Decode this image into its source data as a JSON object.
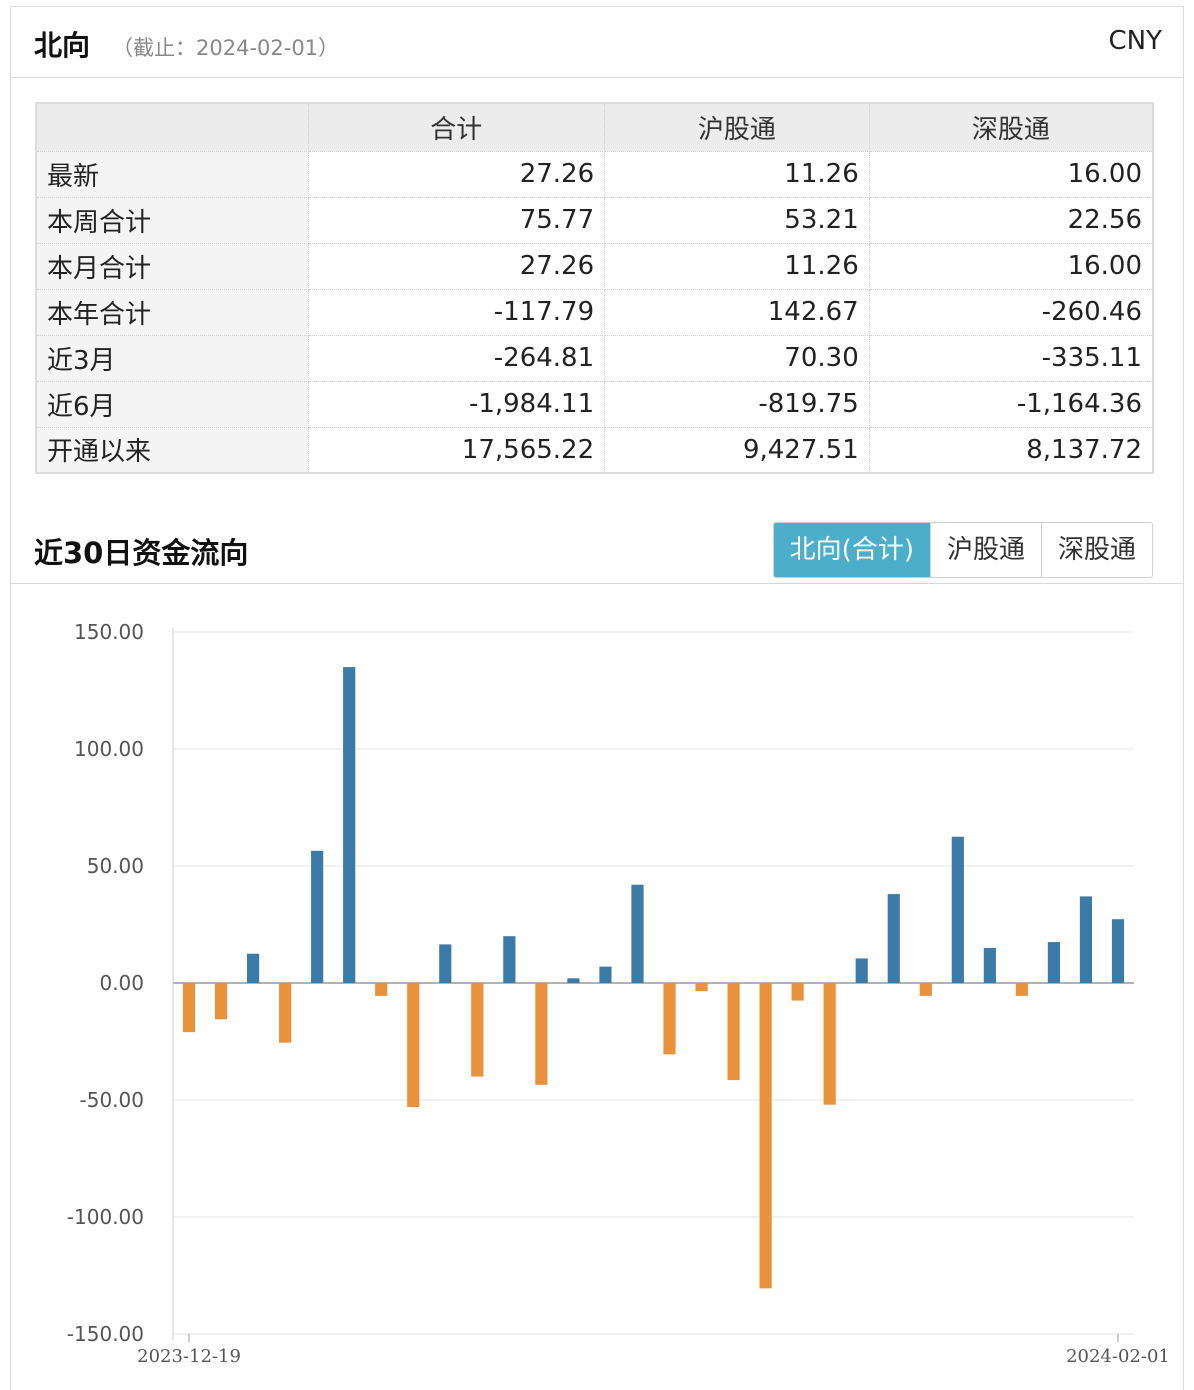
{
  "header": {
    "title": "北向",
    "as_of": "（截止：2024-02-01）",
    "currency": "CNY"
  },
  "summary_table": {
    "columns": [
      "合计",
      "沪股通",
      "深股通"
    ],
    "rows": [
      {
        "label": "最新",
        "values": [
          "27.26",
          "11.26",
          "16.00"
        ]
      },
      {
        "label": "本周合计",
        "values": [
          "75.77",
          "53.21",
          "22.56"
        ]
      },
      {
        "label": "本月合计",
        "values": [
          "27.26",
          "11.26",
          "16.00"
        ]
      },
      {
        "label": "本年合计",
        "values": [
          "-117.79",
          "142.67",
          "-260.46"
        ]
      },
      {
        "label": "近3月",
        "values": [
          "-264.81",
          "70.30",
          "-335.11"
        ]
      },
      {
        "label": "近6月",
        "values": [
          "-1,984.11",
          "-819.75",
          "-1,164.36"
        ]
      },
      {
        "label": "开通以来",
        "values": [
          "17,565.22",
          "9,427.51",
          "8,137.72"
        ]
      }
    ]
  },
  "flow_section": {
    "title": "近30日资金流向",
    "tabs": [
      {
        "label": "北向(合计)",
        "active": true
      },
      {
        "label": "沪股通",
        "active": false
      },
      {
        "label": "深股通",
        "active": false
      }
    ]
  },
  "colors": {
    "positive": "#3e7aa6",
    "negative": "#e8923c",
    "tab_active": "#4daec9"
  },
  "chart_data": {
    "type": "bar",
    "title": "",
    "xlabel": "",
    "ylabel": "",
    "ylim": [
      -150,
      150
    ],
    "yticks": [
      "150.00",
      "100.00",
      "50.00",
      "0.00",
      "-50.00",
      "-100.00",
      "-150.00"
    ],
    "x_tick_labels": [
      "2023-12-19",
      "2024-02-01"
    ],
    "values": [
      -21,
      -15.5,
      12.5,
      -25.5,
      56.5,
      135,
      -5.5,
      -53,
      16.5,
      -40,
      20,
      -43.5,
      2,
      7,
      42,
      -30.5,
      -3.5,
      -41.5,
      -130.5,
      -7.5,
      -52,
      10.5,
      38,
      -5.5,
      62.5,
      15,
      -5.5,
      17.5,
      37,
      27.26
    ],
    "grid": true
  }
}
